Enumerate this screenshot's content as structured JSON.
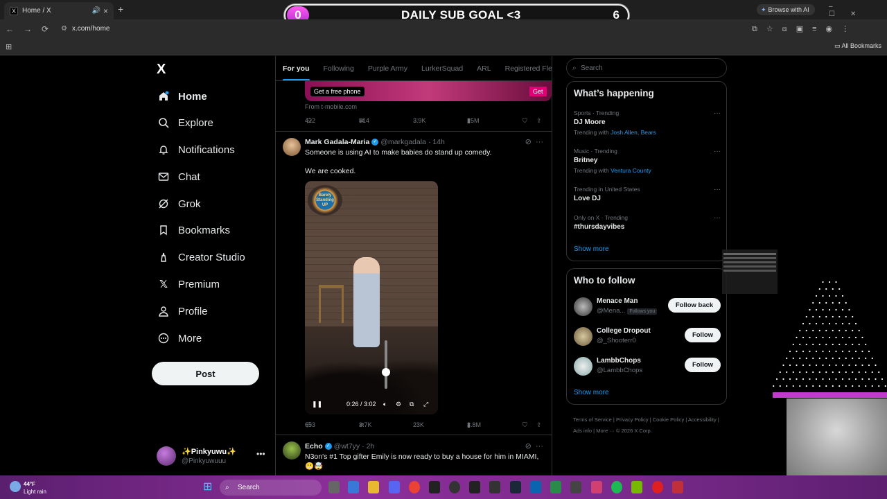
{
  "browser": {
    "tab_title": "Home / X",
    "tab_favicon": "X",
    "new_tab": "+",
    "url": "x.com/home",
    "browse_ai": "Browse with AI",
    "all_bookmarks": "All Bookmarks"
  },
  "stream_overlay": {
    "goal_count": "0",
    "goal_title": "DAILY SUB GOAL <3",
    "goal_target": "6"
  },
  "sidebar": {
    "logo": "X",
    "items": [
      {
        "label": "Home",
        "icon": "home-icon"
      },
      {
        "label": "Explore",
        "icon": "search-icon"
      },
      {
        "label": "Notifications",
        "icon": "bell-icon"
      },
      {
        "label": "Chat",
        "icon": "mail-icon"
      },
      {
        "label": "Grok",
        "icon": "grok-icon"
      },
      {
        "label": "Bookmarks",
        "icon": "bookmark-icon"
      },
      {
        "label": "Creator Studio",
        "icon": "creator-icon"
      },
      {
        "label": "Premium",
        "icon": "x-icon"
      },
      {
        "label": "Profile",
        "icon": "person-icon"
      },
      {
        "label": "More",
        "icon": "more-circle-icon"
      }
    ],
    "post_button": "Post",
    "account": {
      "name": "✨Pinkyuwu✨",
      "handle": "@Pinkyuwuuu"
    }
  },
  "timeline": {
    "tabs": [
      "For you",
      "Following",
      "Purple Army",
      "LurkerSquad",
      "ARL",
      "Registered Fle"
    ],
    "ad": {
      "cta": "Get a free phone",
      "cta2": "Get",
      "from": "From t-mobile.com",
      "replies": "422",
      "reposts": "514",
      "likes": "3.9K",
      "views": "25M"
    },
    "post1": {
      "name": "Mark Gadala-Maria",
      "handle": "@markgadala",
      "time": "· 14h",
      "text1": "Someone is using AI to make babies do stand up comedy.",
      "text2": "We are cooked.",
      "neon_sign": "Barely Standing UP",
      "video_time": "0:26 / 3:02",
      "replies": "653",
      "reposts": "3.7K",
      "likes": "23K",
      "views": "3.8M"
    },
    "post2": {
      "name": "Echo",
      "handle": "@wt7yy",
      "time": "· 2h",
      "text": "N3on's #1 Top gifter Emily is now ready to buy a house for him in MIAMI, 😬🤯"
    }
  },
  "right": {
    "search_placeholder": "Search",
    "happening_title": "What’s happening",
    "trends": [
      {
        "cat": "Sports · Trending",
        "name": "DJ Moore",
        "with_prefix": "Trending with",
        "with": "Josh Allen, Bears"
      },
      {
        "cat": "Music · Trending",
        "name": "Britney",
        "with_prefix": "Trending with",
        "with": "Ventura County"
      },
      {
        "cat": "Trending in United States",
        "name": "Love DJ"
      },
      {
        "cat": "Only on X · Trending",
        "name": "#thursdayvibes"
      }
    ],
    "show_more": "Show more",
    "wtf_title": "Who to follow",
    "follows": [
      {
        "name": "Menace Man",
        "handle": "@Mena...",
        "follows_you": "Follows you",
        "button": "Follow back"
      },
      {
        "name": "College Dropout",
        "handle": "@_Shooterr0",
        "button": "Follow"
      },
      {
        "name": "LambbChops",
        "handle": "@LambbChops",
        "button": "Follow"
      }
    ],
    "show_more2": "Show more",
    "footer": "Terms of Service  |  Privacy Policy  |  Cookie Policy  |  Accessibility  |  Ads info  |  More ···  © 2026 X Corp."
  },
  "taskbar": {
    "temp": "44°F",
    "condition": "Light rain",
    "search": "Search"
  }
}
